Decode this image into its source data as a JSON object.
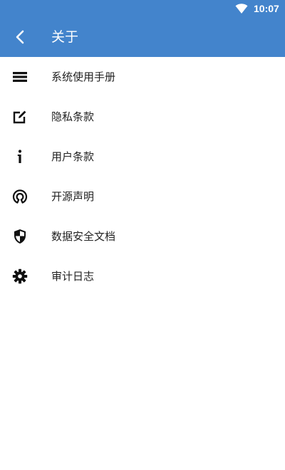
{
  "status_bar": {
    "time": "10:07",
    "wifi_icon": "wifi-icon"
  },
  "header": {
    "back_icon": "chevron-left-icon",
    "title": "关于",
    "background": "#4384cc"
  },
  "menu": {
    "items": [
      {
        "icon": "list-icon",
        "label": "系统使用手册"
      },
      {
        "icon": "edit-icon",
        "label": "隐私条款"
      },
      {
        "icon": "info-icon",
        "label": "用户条款"
      },
      {
        "icon": "open-source-icon",
        "label": "开源声明"
      },
      {
        "icon": "shield-icon",
        "label": "数据安全文档"
      },
      {
        "icon": "gear-icon",
        "label": "审计日志"
      }
    ]
  }
}
